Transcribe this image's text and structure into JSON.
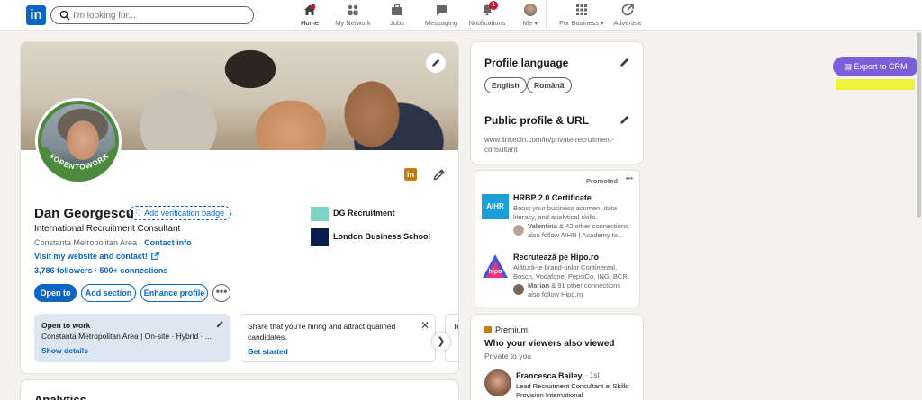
{
  "nav": {
    "logo": "in",
    "search_placeholder": "I'm looking for...",
    "items": [
      {
        "label": "Home",
        "icon": "home-icon"
      },
      {
        "label": "My Network",
        "icon": "network-icon"
      },
      {
        "label": "Jobs",
        "icon": "briefcase-icon"
      },
      {
        "label": "Messaging",
        "icon": "chat-icon"
      },
      {
        "label": "Notifications",
        "icon": "bell-icon",
        "badge": "1"
      },
      {
        "label": "Me",
        "icon": "avatar-icon"
      },
      {
        "label": "For Business",
        "icon": "grid-icon"
      },
      {
        "label": "Advertise",
        "icon": "advertise-icon"
      }
    ]
  },
  "profile": {
    "avatar_badge": "#OPENTOWORK",
    "name": "Dan Georgescu",
    "verify_label": "Add verification badge",
    "headline": "International Recruitment Consultant",
    "location": "Constanta Metropolitan Area",
    "contact_info": "Contact info",
    "website": "Visit my website and contact!",
    "followers": "3,786 followers",
    "connections": "500+ connections",
    "buttons": {
      "open_to": "Open to",
      "add_section": "Add section",
      "enhance": "Enhance profile",
      "more": "•••"
    },
    "orgs": [
      {
        "name": "DG Recruitment",
        "logo_color": "#7dd5c8"
      },
      {
        "name": "London Business School",
        "logo_color": "#0b1d4a"
      }
    ],
    "open_to_work": {
      "title": "Open to work",
      "detail": "Constanta Metropolitan Area | On-site · Hybrid · ...",
      "link": "Show details"
    },
    "hiring": {
      "text_bold": "Share that you're hiring",
      "text_rest": " and attract qualified",
      "text_line2": "candidates.",
      "link": "Get started"
    },
    "partial_card_text": "Te"
  },
  "analytics_title": "Analytics",
  "sidebar": {
    "language": {
      "title": "Profile language",
      "options": [
        "English",
        "Română"
      ]
    },
    "public_profile": {
      "title": "Public profile & URL",
      "url_line1": "www.linkedin.com/in/private-recruitment-",
      "url_line2": "consultant"
    },
    "promoted": {
      "label": "Promoted",
      "more": "•••",
      "items": [
        {
          "logo_text": "AIHR",
          "title": "HRBP 2.0 Certificate",
          "desc1": "Boost your business acumen, data",
          "desc2": "literacy, and analytical skills.",
          "follower_bold": "Valentina",
          "follower_rest": " & 42 other connections",
          "follower_line2": "also follow AIHR | Academy to..."
        },
        {
          "logo_text": "hipo",
          "title": "Recrutează pe Hipo.ro",
          "desc1": "Alătură-te brand-urilor Continental,",
          "desc2": "Bosch, Vodafone, PepsiCo, ING, BCR.",
          "follower_bold": "Marian",
          "follower_rest": " & 91 other connections",
          "follower_line2": "also follow Hipo.ro"
        }
      ]
    },
    "premium": {
      "label": "Premium",
      "title": "Who your viewers also viewed",
      "subtitle": "Private to you",
      "viewer": {
        "name": "Francesca Bailey",
        "degree": "· 1st",
        "headline1": "Lead Recruitment Consultant at Skills",
        "headline2": "Provision International"
      }
    }
  },
  "extension": {
    "export_label": "Export to CRM"
  },
  "colors": {
    "brand": "#0a66c2",
    "crm": "#7b5fd9",
    "highlight": "#eef23a"
  }
}
